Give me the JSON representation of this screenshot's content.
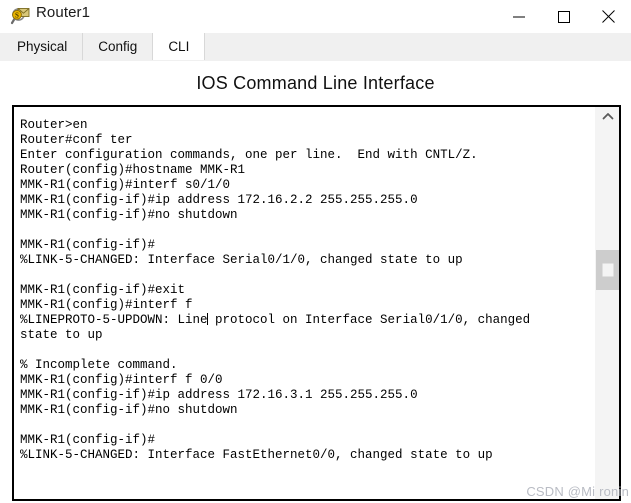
{
  "window": {
    "title": "Router1",
    "icon": "router-device-icon",
    "controls": {
      "minimize": "minimize-icon",
      "maximize": "maximize-icon",
      "close": "close-icon"
    }
  },
  "tabs": [
    {
      "label": "Physical",
      "active": false
    },
    {
      "label": "Config",
      "active": false
    },
    {
      "label": "CLI",
      "active": true
    }
  ],
  "heading": "IOS Command Line Interface",
  "terminal": {
    "lines": [
      "Router>en",
      "Router#conf ter",
      "Enter configuration commands, one per line.  End with CNTL/Z.",
      "Router(config)#hostname MMK-R1",
      "MMK-R1(config)#interf s0/1/0",
      "MMK-R1(config-if)#ip address 172.16.2.2 255.255.255.0",
      "MMK-R1(config-if)#no shutdown",
      "",
      "MMK-R1(config-if)#",
      "%LINK-5-CHANGED: Interface Serial0/1/0, changed state to up",
      "",
      "MMK-R1(config-if)#exit",
      "MMK-R1(config)#interf f",
      "%LINEPROTO-5-UPDOWN: Line| protocol on Interface Serial0/1/0, changed",
      "state to up",
      "",
      "% Incomplete command.",
      "MMK-R1(config)#interf f 0/0",
      "MMK-R1(config-if)#ip address 172.16.3.1 255.255.255.0",
      "MMK-R1(config-if)#no shutdown",
      "",
      "MMK-R1(config-if)#",
      "%LINK-5-CHANGED: Interface FastEthernet0/0, changed state to up"
    ],
    "caret_line_index": 13,
    "caret_prefix": "%LINEPROTO-5-UPDOWN: Line",
    "caret_suffix": " protocol on Interface Serial0/1/0, changed"
  },
  "scrollbar": {
    "up_arrow": "chevron-up-icon",
    "thumb_position_label": "thumb"
  },
  "watermark": "CSDN @Mi ronin",
  "colors": {
    "tab_bar": "#f0f0f0",
    "active_tab": "#ffffff",
    "terminal_border": "#000000",
    "scrollbar_track": "#f4f4f4",
    "scrollbar_thumb": "#cdcdcd",
    "watermark": "#b9bcc4",
    "text": "#000000"
  }
}
